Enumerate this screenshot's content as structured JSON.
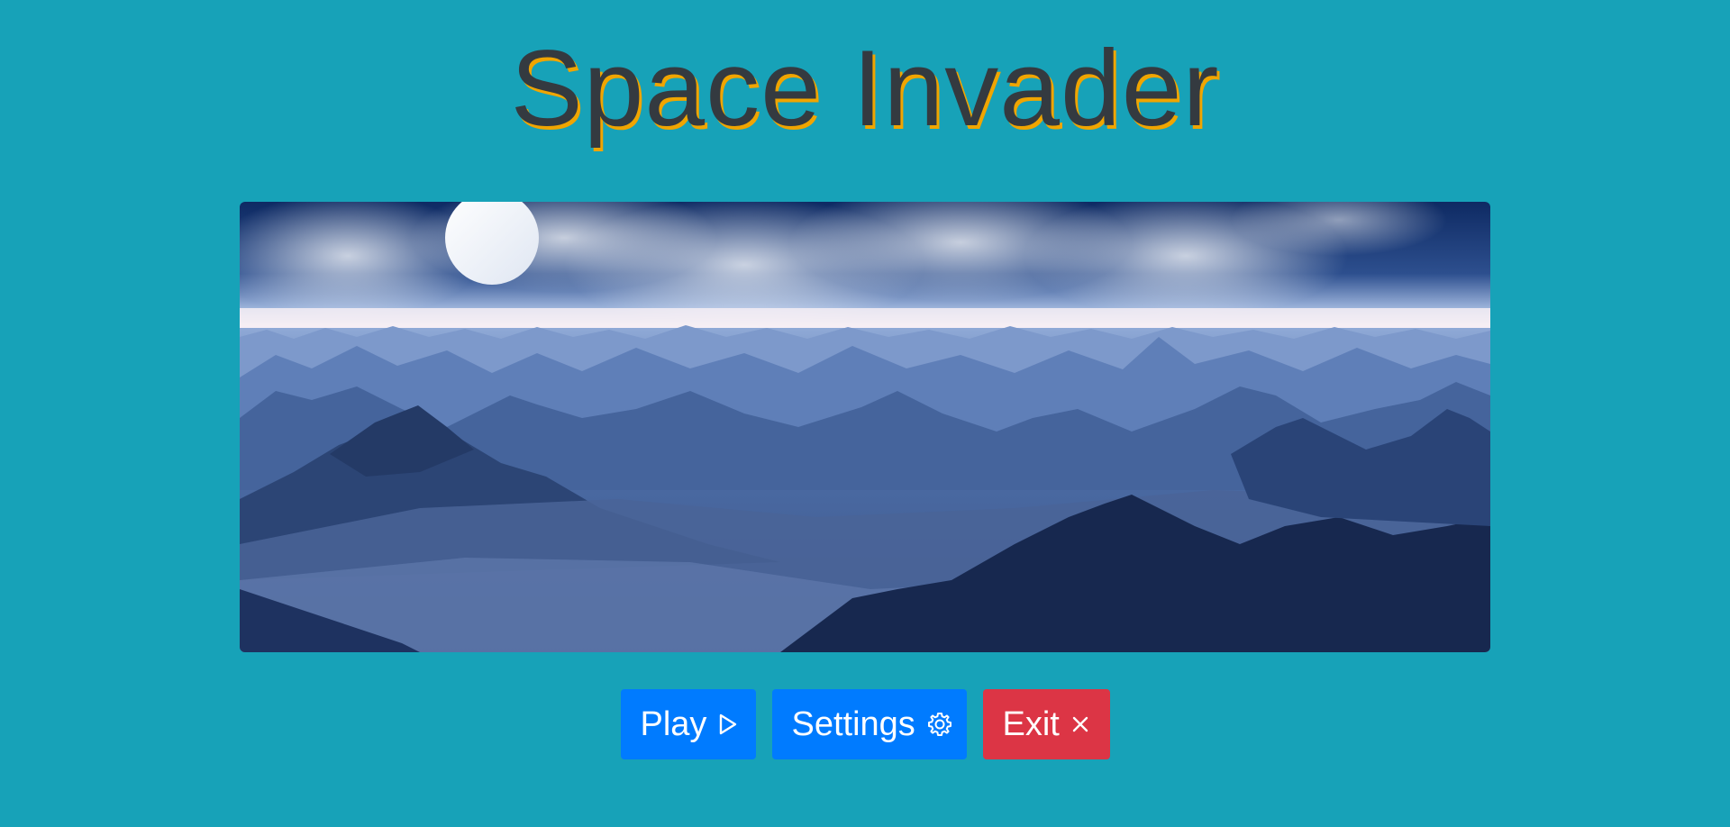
{
  "title": "Space Invader",
  "hero_image": {
    "description_icon": "mountain-landscape-image",
    "colors": {
      "sky_top": "#0e2a63",
      "horizon": "#f3ecf2",
      "moon": "#ffffff",
      "mountain_far": "#5578b0",
      "mountain_mid": "#3b5a92",
      "mountain_near": "#1a2e5a"
    }
  },
  "buttons": {
    "play": {
      "label": "Play",
      "icon": "play-outline-icon"
    },
    "settings": {
      "label": "Settings",
      "icon": "gear-icon"
    },
    "exit": {
      "label": "Exit",
      "icon": "close-icon"
    }
  },
  "theme": {
    "background": "#17a2b8",
    "title_color": "#343a40",
    "title_shadow": "#f0a500",
    "primary": "#007bff",
    "danger": "#dc3545"
  }
}
